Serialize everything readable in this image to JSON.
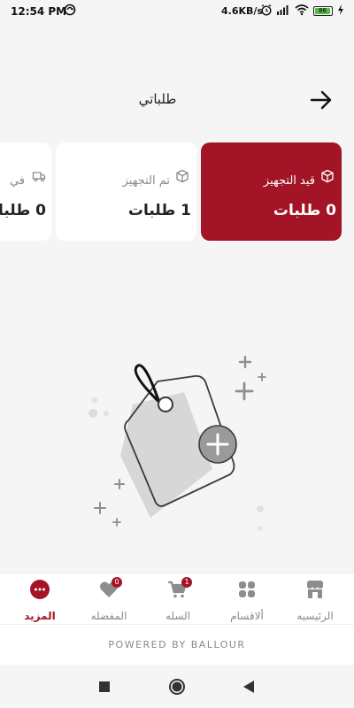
{
  "status_bar": {
    "time": "12:54 PM",
    "network_speed": "4.6KB/s",
    "battery_level": "86",
    "icons": [
      "sync-icon",
      "alarm-icon",
      "signal-icon",
      "wifi-icon",
      "battery-icon",
      "charging-icon"
    ]
  },
  "header": {
    "title": "طلباتي",
    "back_icon": "arrow-right-icon"
  },
  "order_status_cards": [
    {
      "label": "قيد التجهيز",
      "count": "0 طلبات",
      "icon": "box-icon",
      "selected": true
    },
    {
      "label": "تم التجهيز",
      "count": "1 طلبات",
      "icon": "box-icon",
      "selected": false
    },
    {
      "label": "في",
      "count": "0 طلبا",
      "icon": "truck-icon",
      "selected": false
    }
  ],
  "empty_state": {
    "icon": "price-tag-add-icon"
  },
  "bottom_nav": {
    "items": [
      {
        "label": "الرئيسيه",
        "icon": "store-icon",
        "active": false
      },
      {
        "label": "ألاقسام",
        "icon": "grid-icon",
        "active": false
      },
      {
        "label": "السله",
        "icon": "cart-icon",
        "badge": "1",
        "active": false
      },
      {
        "label": "المفضله",
        "icon": "heart-icon",
        "badge": "0",
        "active": false
      },
      {
        "label": "المزيد",
        "icon": "more-icon",
        "active": true
      }
    ]
  },
  "footer": {
    "powered_by": "POWERED BY BALLOUR"
  },
  "system_nav": {
    "buttons": [
      "recents-icon",
      "home-icon",
      "back-icon"
    ]
  },
  "colors": {
    "accent": "#a31526",
    "background": "#f4f5f4",
    "card": "#ffffff",
    "muted_text": "#8a8a8a"
  }
}
